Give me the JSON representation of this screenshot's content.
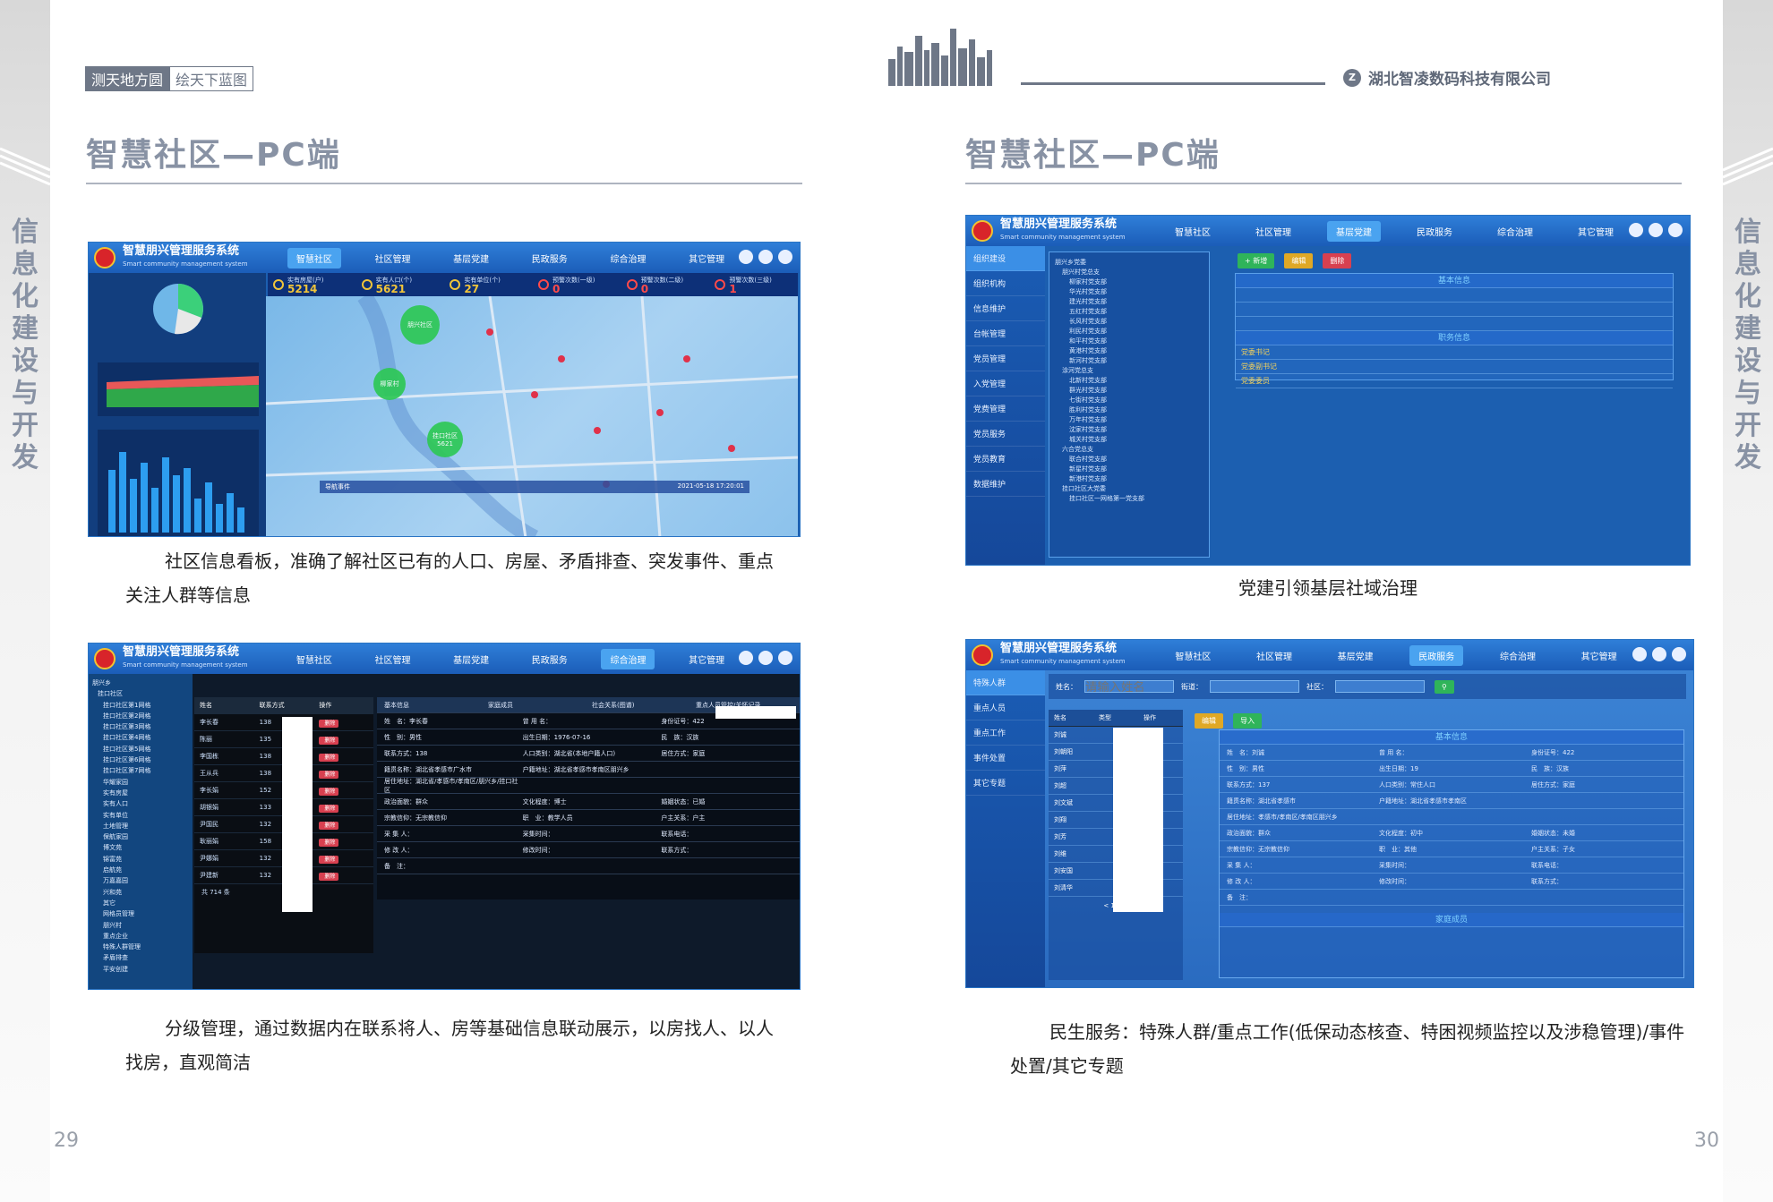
{
  "left_page": {
    "brand_tags": [
      "测天地方圆",
      "绘天下蓝图"
    ],
    "vertical_label": "信息化建设与开发",
    "title": "智慧社区—PC端",
    "captions": [
      "社区信息看板，准确了解社区已有的人口、房屋、矛盾排查、突发事件、重点关注人群等信息",
      "分级管理，通过数据内在联系将人、房等基础信息联动展示，以房找人、以人找房，直观简洁"
    ],
    "page_number": "29"
  },
  "right_page": {
    "company": "湖北智凌数码科技有限公司",
    "company_logo": "Z",
    "vertical_label": "信息化建设与开发",
    "title": "智慧社区—PC端",
    "captions": [
      "党建引领基层社域治理",
      "民生服务：特殊人群/重点工作(低保动态核查、特困视频监控以及涉稳管理)/事件处置/其它专题"
    ],
    "page_number": "30"
  },
  "app": {
    "name": "智慧朋兴管理服务系统",
    "name_en": "Smart community management system",
    "nav": [
      "智慧社区",
      "社区管理",
      "基层党建",
      "民政服务",
      "综合治理",
      "其它管理"
    ]
  },
  "dashboard": {
    "stats": [
      {
        "label": "实有房屋(户)",
        "value": "5214"
      },
      {
        "label": "实有人口(个)",
        "value": "5621"
      },
      {
        "label": "实有单位(个)",
        "value": "27"
      },
      {
        "label": "预警次数(一级)",
        "value": "0"
      },
      {
        "label": "预警次数(二级)",
        "value": "0"
      },
      {
        "label": "预警次数(三级)",
        "value": "1"
      }
    ],
    "event_banner": "导航事件",
    "timestamp": "2021-05-18 17:20:01",
    "bubbles": [
      "朋兴社区",
      "柳家村",
      "挂口社区\n5621"
    ]
  },
  "party_screen": {
    "side_menu": [
      "组织建设",
      "组织机构",
      "信息维护",
      "台帐管理",
      "党员管理",
      "入党管理",
      "党费管理",
      "党员服务",
      "党员教育",
      "数据维护"
    ],
    "buttons": [
      "+ 新增",
      "编辑",
      "删除"
    ],
    "section_basic": "基本信息",
    "section_duties": "职务信息",
    "rows": [
      "党委书记",
      "党委副书记",
      "党委委员"
    ],
    "tree": [
      "朋兴乡党委",
      "朋兴村党总支",
      "柳家村党支部",
      "华光村党支部",
      "建光村党支部",
      "五红村党支部",
      "长风村党支部",
      "利民村党支部",
      "和平村党支部",
      "黄港村党支部",
      "新河村党支部",
      "涂河党总支",
      "北新村党支部",
      "群光村党支部",
      "七街村党支部",
      "胜利村党支部",
      "万年村党支部",
      "沈家村党支部",
      "城关村党支部",
      "六合党总支",
      "联合村党支部",
      "新星村党支部",
      "新港村党支部",
      "挂口社区大党委",
      "挂口社区一网格第一党支部"
    ]
  },
  "grid_screen": {
    "tree": [
      "朋兴乡",
      "挂口社区",
      "挂口社区第1网格",
      "挂口社区第2网格",
      "挂口社区第3网格",
      "挂口社区第4网格",
      "挂口社区第5网格",
      "挂口社区第6网格",
      "挂口社区第7网格",
      "华耀家园",
      "实有房屋",
      "实有人口",
      "实有单位",
      "土地管理",
      "保航家园",
      "博文苑",
      "锦富苑",
      "启航苑",
      "万嘉嘉园",
      "兴和苑",
      "其它",
      "网格员管理",
      "朋兴村",
      "重点企业",
      "特殊人群管理",
      "矛盾排查",
      "平安创建"
    ],
    "tabs": [
      "基本信息",
      "家庭成员",
      "社会关系(图谱)",
      "重点人员管控/关怀记录"
    ],
    "columns": [
      "姓名",
      "联系方式",
      "操作"
    ],
    "names": [
      "李长春",
      "陈丽",
      "李国栋",
      "王从兵",
      "李长娟",
      "胡银娟",
      "尹国民",
      "耿丽娟",
      "尹娜娟",
      "尹建新"
    ],
    "phone_prefix": [
      "138",
      "135",
      "138",
      "138",
      "152",
      "133",
      "132",
      "158",
      "132",
      "132"
    ],
    "pagination": "共 714 条",
    "detail": [
      [
        "姓　名：李长春",
        "曾 用 名：",
        "身份证号：422"
      ],
      [
        "性　别：男性",
        "出生日期：1976-07-16",
        "民　族：汉族"
      ],
      [
        "联系方式：138",
        "人口类别：湖北省(本地户籍人口)",
        "居住方式：家庭"
      ],
      [
        "籍贯名称：湖北省孝感市广水市",
        "户籍地址：湖北省孝感市孝南区朋兴乡",
        ""
      ],
      [
        "居住地址：湖北省/孝感市/孝南区/朋兴乡/挂口社区",
        "",
        ""
      ],
      [
        "政治面貌：群众",
        "文化程度：博士",
        "婚姻状态：已婚"
      ],
      [
        "宗教信仰：无宗教信仰",
        "职　业：教学人员",
        "户主关系：户主"
      ],
      [
        "采 集 人：",
        "采集时间：",
        "联系电话："
      ],
      [
        "修 改 人：",
        "修改时间：",
        "联系方式："
      ],
      [
        "备　注：",
        "",
        ""
      ]
    ]
  },
  "service_screen": {
    "side_menu": [
      "特殊人群",
      "重点人员",
      "重点工作",
      "事件处置",
      "其它专题"
    ],
    "filters": [
      "姓名：",
      "街道：",
      "社区："
    ],
    "filter_placeholder": "请输入姓名",
    "columns": [
      "姓名",
      "类型",
      "操作"
    ],
    "names": [
      "刘诚",
      "刘朝阳",
      "刘萍",
      "刘超",
      "刘文斌",
      "刘翔",
      "刘芳",
      "刘维",
      "刘安国",
      "刘清华"
    ],
    "section_basic": "基本信息",
    "section_family": "家庭成员",
    "buttons": [
      "编辑",
      "导入"
    ],
    "pagination": "< 1 2 >",
    "detail": [
      [
        "姓　名：刘诚",
        "曾 用 名：",
        "身份证号：422"
      ],
      [
        "性　别：男性",
        "出生日期：19",
        "民　族：汉族"
      ],
      [
        "联系方式：137",
        "人口类别：常住人口",
        "居住方式：家庭"
      ],
      [
        "籍贯名称：湖北省孝感市",
        "户籍地址：湖北省孝感市孝南区",
        ""
      ],
      [
        "居住地址：孝感市/孝南区/孝南区朋兴乡",
        "",
        ""
      ],
      [
        "政治面貌：群众",
        "文化程度：初中",
        "婚姻状态：未婚"
      ],
      [
        "宗教信仰：无宗教信仰",
        "职　业：其他",
        "户主关系：子女"
      ],
      [
        "采 集 人：",
        "采集时间：",
        "联系电话："
      ],
      [
        "修 改 人：",
        "修改时间：",
        "联系方式："
      ],
      [
        "备　注：",
        "",
        ""
      ]
    ]
  },
  "colors": {
    "accent_grey": "#8892a4",
    "ui_blue": "#1c5fb0"
  }
}
